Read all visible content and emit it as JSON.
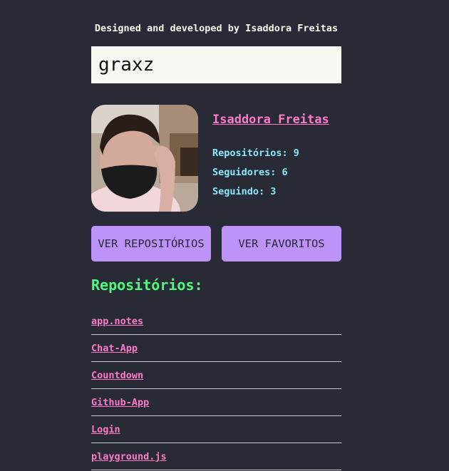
{
  "header": {
    "credit": "Designed and developed by Isaddora Freitas"
  },
  "search": {
    "value": "graxz"
  },
  "profile": {
    "name": "Isaddora Freitas",
    "repositories": "Repositórios: 9",
    "followers": "Seguidores: 6",
    "following": "Seguindo: 3"
  },
  "actions": {
    "repos_label": "VER REPOSITÓRIOS",
    "favorites_label": "VER FAVORITOS"
  },
  "repos_section": {
    "title": "Repositórios:",
    "items": [
      "app.notes",
      "Chat-App",
      "Countdown",
      "Github-App",
      "Login",
      "playground.js"
    ]
  },
  "colors": {
    "background": "#282a36",
    "link": "#ff79c6",
    "stats": "#8be9fd",
    "button": "#bd93f9",
    "section_title": "#50fa7b"
  }
}
